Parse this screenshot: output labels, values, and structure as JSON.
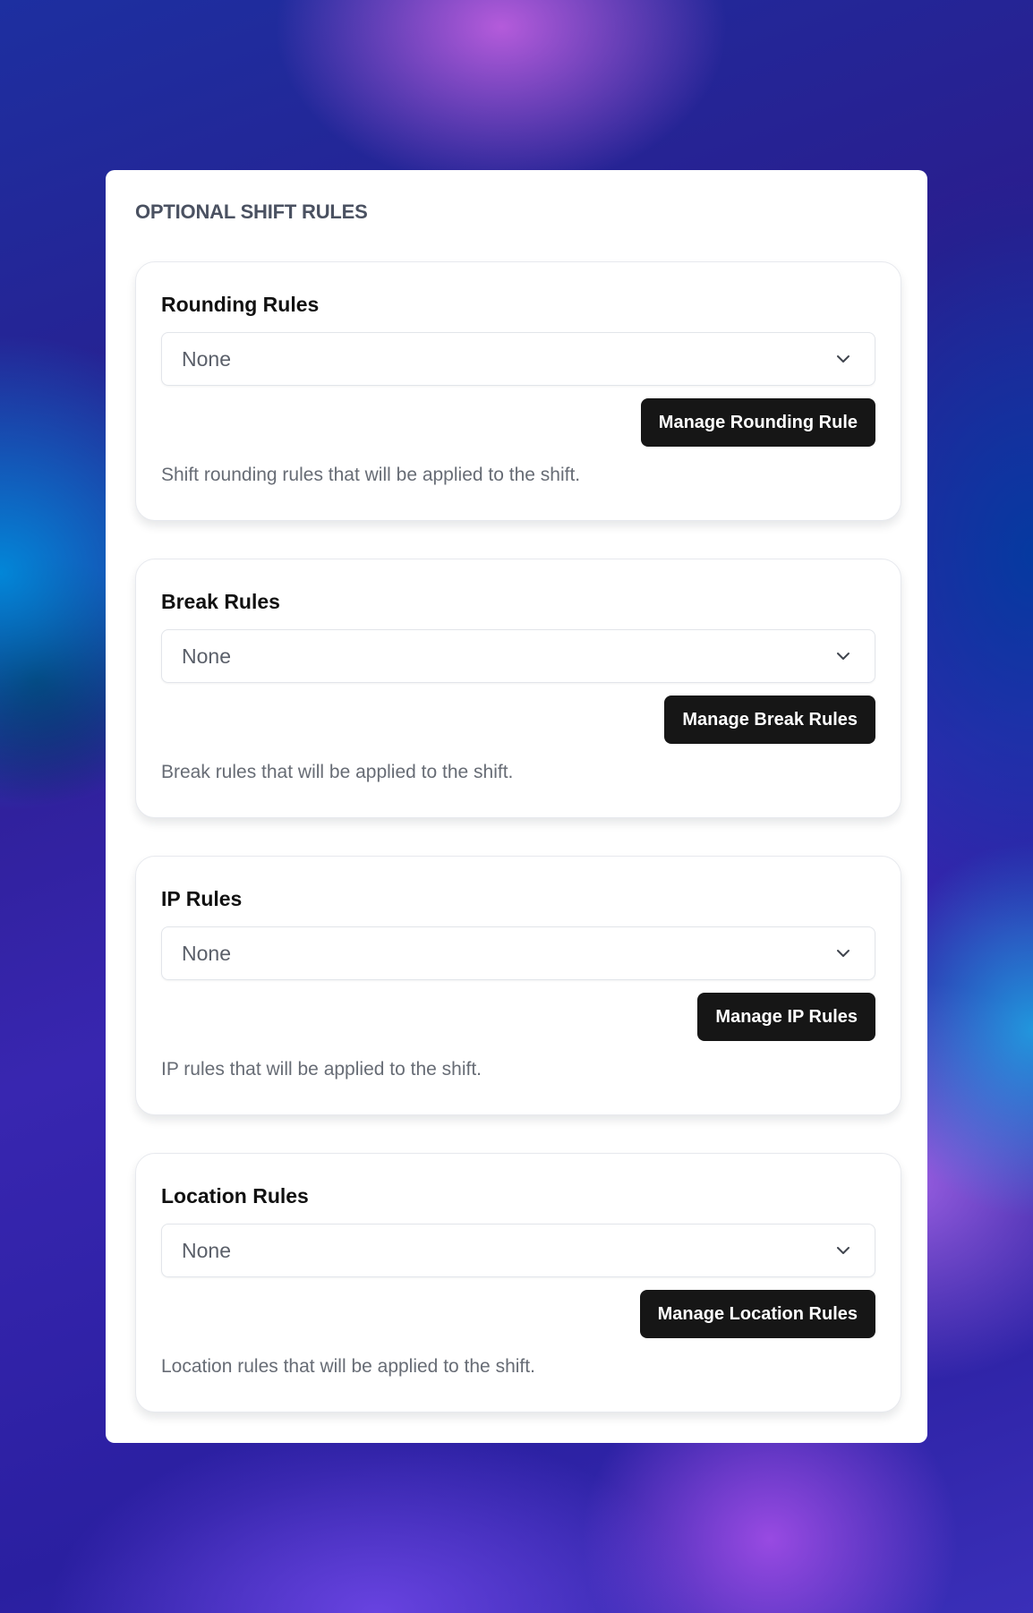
{
  "panel": {
    "title": "OPTIONAL SHIFT RULES"
  },
  "rules": [
    {
      "title": "Rounding Rules",
      "selected": "None",
      "button_label": "Manage Rounding Rule",
      "description": "Shift rounding rules that will be applied to the shift."
    },
    {
      "title": "Break Rules",
      "selected": "None",
      "button_label": "Manage Break Rules",
      "description": "Break rules that will be applied to the shift."
    },
    {
      "title": "IP Rules",
      "selected": "None",
      "button_label": "Manage IP Rules",
      "description": "IP rules that will be applied to the shift."
    },
    {
      "title": "Location Rules",
      "selected": "None",
      "button_label": "Manage Location Rules",
      "description": "Location rules that will be applied to the shift."
    }
  ],
  "icons": {
    "dropdown": "chevron-down-icon"
  },
  "colors": {
    "button_bg": "#161616",
    "button_text": "#ffffff",
    "title_text": "#4a5161"
  }
}
